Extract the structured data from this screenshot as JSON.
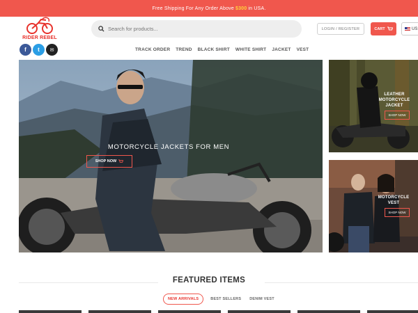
{
  "topbar": {
    "text_before": "Free Shipping For Any Order Above",
    "amount": "$300",
    "text_after": "in USA."
  },
  "logo": {
    "text": "RIDER REBEL"
  },
  "search": {
    "placeholder": "Search for products..."
  },
  "header": {
    "login": "LOGIN / REGISTER",
    "cart": "CART",
    "lang": "US"
  },
  "social": [
    {
      "icon": "facebook-icon",
      "glyph": "f",
      "color": "#3b5998"
    },
    {
      "icon": "twitter-icon",
      "glyph": "t",
      "color": "#2b9ee5"
    },
    {
      "icon": "email-icon",
      "glyph": "✉",
      "color": "#222222"
    }
  ],
  "nav": [
    "TRACK ORDER",
    "TREND",
    "BLACK SHIRT",
    "WHITE SHIRT",
    "JACKET",
    "VEST"
  ],
  "hero": {
    "title": "MOTORCYCLE JACKETS FOR MEN",
    "button": "SHOP NOW"
  },
  "side1": {
    "title_lines": [
      "LEATHER",
      "MOTORCYCLE",
      "JACKET"
    ],
    "button": "SHOP NOW"
  },
  "side2": {
    "title_lines": [
      "MOTORCYCLE",
      "VEST"
    ],
    "button": "SHOP NOW"
  },
  "featured": {
    "title": "FEATURED ITEMS",
    "tabs": [
      "NEW ARRIVALS",
      "BEST SELLERS",
      "DENIM VEST"
    ]
  },
  "colors": {
    "brand": "#f0574d",
    "accent_amount": "#ffd23a"
  }
}
